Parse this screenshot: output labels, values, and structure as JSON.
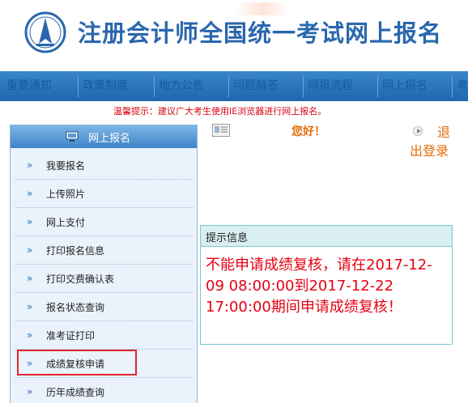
{
  "header": {
    "title": "注册会计师全国统一考试网上报名",
    "logo_icon": "cicpa-emblem-icon"
  },
  "nav": {
    "items": [
      "重要通知",
      "政策制度",
      "地方公告",
      "问题解答",
      "网报流程",
      "网上报名",
      "考"
    ]
  },
  "tip": {
    "text": "温馨提示：建议广大考生使用IE浏览器进行网上报名。"
  },
  "sidebar": {
    "title": "网上报名",
    "items": [
      {
        "label": "我要报名"
      },
      {
        "label": "上传照片"
      },
      {
        "label": "网上支付"
      },
      {
        "label": "打印报名信息"
      },
      {
        "label": "打印交费确认表"
      },
      {
        "label": "报名状态查询"
      },
      {
        "label": "准考证打印"
      },
      {
        "label": "成绩复核申请"
      },
      {
        "label": "历年成绩查询"
      }
    ],
    "arrow": "»"
  },
  "user": {
    "greeting": "您好！",
    "logout_1": "退",
    "logout_2": "出登录"
  },
  "panel": {
    "title": "提示信息",
    "message": "不能申请成绩复核，请在2017-12-09 08:00:00到2017-12-22 17:00:00期间申请成绩复核！"
  },
  "colors": {
    "title_blue": "#2a67ad",
    "nav_blue": "#2a76bf",
    "warning_red": "#e60012",
    "orange": "#e46c0a",
    "highlight": "#e0262a"
  }
}
